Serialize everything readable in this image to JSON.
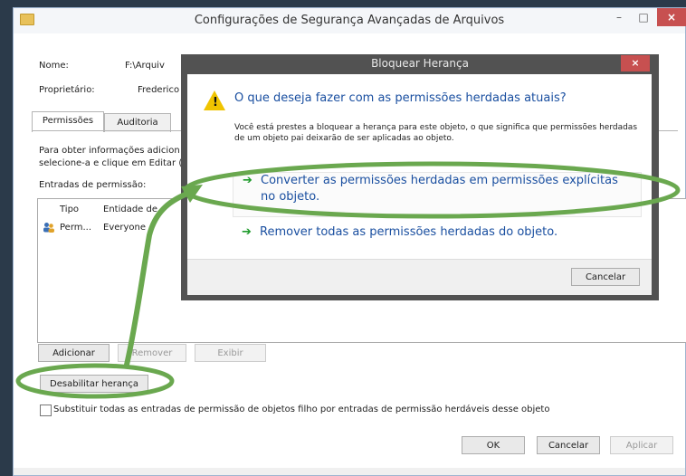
{
  "window": {
    "title": "Configurações de Segurança Avançadas de Arquivos",
    "min_glyph": "–",
    "max_glyph": "□",
    "close_glyph": "×"
  },
  "fields": {
    "name_label": "Nome:",
    "name_value": "F:\\Arquiv",
    "owner_label": "Proprietário:",
    "owner_value": "Frederico"
  },
  "tabs": [
    "Permissões",
    "Auditoria"
  ],
  "info_text_1": "Para obter informações adicion",
  "info_text_2": "selecione-a e clique em Editar (",
  "entries_label": "Entradas de permissão:",
  "table": {
    "headers": [
      "Tipo",
      "Entidade de"
    ],
    "rows": [
      {
        "type": "Perm...",
        "entity": "Everyone"
      }
    ]
  },
  "buttons": {
    "add": "Adicionar",
    "remove": "Remover",
    "view": "Exibir",
    "disable_inheritance": "Desabilitar herança",
    "ok": "OK",
    "cancel": "Cancelar",
    "apply": "Aplicar"
  },
  "replace_checkbox_label": "Substituir todas as entradas de permissão de objetos filho por entradas de permissão herdáveis desse objeto",
  "modal": {
    "title": "Bloquear Herança",
    "close_glyph": "×",
    "heading": "O que deseja fazer com as permissões herdadas atuais?",
    "description": "Você está prestes a bloquear a herança para este objeto, o que significa que permissões herdadas de um objeto pai deixarão de ser aplicadas ao objeto.",
    "option_convert": "Converter as permissões herdadas em permissões explícitas no objeto.",
    "option_remove": "Remover todas as permissões herdadas do objeto.",
    "arrow_glyph": "➔",
    "cancel": "Cancelar"
  },
  "colors": {
    "annotation_green": "#6aa84f",
    "link_blue": "#1a4fa0",
    "close_red": "#c75050"
  }
}
